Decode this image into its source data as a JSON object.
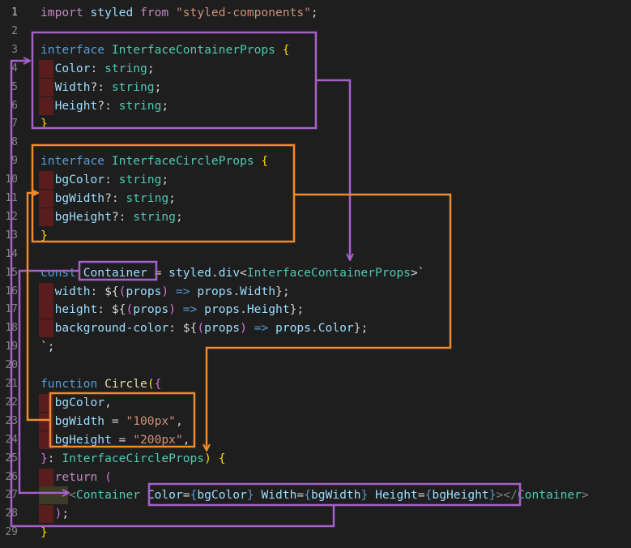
{
  "lines": [
    {
      "num": "1",
      "tokens": [
        {
          "c": "k",
          "t": "import"
        },
        {
          "c": "p",
          "t": " "
        },
        {
          "c": "v",
          "t": "styled"
        },
        {
          "c": "p",
          "t": " "
        },
        {
          "c": "k",
          "t": "from"
        },
        {
          "c": "p",
          "t": " "
        },
        {
          "c": "s",
          "t": "\"styled-components\""
        },
        {
          "c": "p",
          "t": ";"
        }
      ]
    },
    {
      "num": "2",
      "tokens": []
    },
    {
      "num": "3",
      "tokens": [
        {
          "c": "b",
          "t": "interface"
        },
        {
          "c": "p",
          "t": " "
        },
        {
          "c": "t",
          "t": "InterfaceContainerProps"
        },
        {
          "c": "p",
          "t": " "
        },
        {
          "c": "br1",
          "t": "{"
        }
      ]
    },
    {
      "num": "4",
      "tokens": [
        {
          "c": "p",
          "t": "  "
        },
        {
          "c": "v",
          "t": "Color"
        },
        {
          "c": "p",
          "t": ": "
        },
        {
          "c": "t",
          "t": "string"
        },
        {
          "c": "p",
          "t": ";"
        }
      ]
    },
    {
      "num": "5",
      "tokens": [
        {
          "c": "p",
          "t": "  "
        },
        {
          "c": "v",
          "t": "Width"
        },
        {
          "c": "p",
          "t": "?: "
        },
        {
          "c": "t",
          "t": "string"
        },
        {
          "c": "p",
          "t": ";"
        }
      ]
    },
    {
      "num": "6",
      "tokens": [
        {
          "c": "p",
          "t": "  "
        },
        {
          "c": "v",
          "t": "Height"
        },
        {
          "c": "p",
          "t": "?: "
        },
        {
          "c": "t",
          "t": "string"
        },
        {
          "c": "p",
          "t": ";"
        }
      ]
    },
    {
      "num": "7",
      "tokens": [
        {
          "c": "br1",
          "t": "}"
        }
      ]
    },
    {
      "num": "8",
      "tokens": []
    },
    {
      "num": "9",
      "tokens": [
        {
          "c": "b",
          "t": "interface"
        },
        {
          "c": "p",
          "t": " "
        },
        {
          "c": "t",
          "t": "InterfaceCircleProps"
        },
        {
          "c": "p",
          "t": " "
        },
        {
          "c": "br1",
          "t": "{"
        }
      ]
    },
    {
      "num": "10",
      "tokens": [
        {
          "c": "p",
          "t": "  "
        },
        {
          "c": "v",
          "t": "bgColor"
        },
        {
          "c": "p",
          "t": ": "
        },
        {
          "c": "t",
          "t": "string"
        },
        {
          "c": "p",
          "t": ";"
        }
      ]
    },
    {
      "num": "11",
      "tokens": [
        {
          "c": "p",
          "t": "  "
        },
        {
          "c": "v",
          "t": "bgWidth"
        },
        {
          "c": "p",
          "t": "?: "
        },
        {
          "c": "t",
          "t": "string"
        },
        {
          "c": "p",
          "t": ";"
        }
      ]
    },
    {
      "num": "12",
      "tokens": [
        {
          "c": "p",
          "t": "  "
        },
        {
          "c": "v",
          "t": "bgHeight"
        },
        {
          "c": "p",
          "t": "?: "
        },
        {
          "c": "t",
          "t": "string"
        },
        {
          "c": "p",
          "t": ";"
        }
      ]
    },
    {
      "num": "13",
      "tokens": [
        {
          "c": "br1",
          "t": "}"
        }
      ]
    },
    {
      "num": "14",
      "tokens": []
    },
    {
      "num": "15",
      "tokens": [
        {
          "c": "b",
          "t": "const"
        },
        {
          "c": "p",
          "t": " "
        },
        {
          "c": "v",
          "t": "Container"
        },
        {
          "c": "p",
          "t": " = "
        },
        {
          "c": "v",
          "t": "styled"
        },
        {
          "c": "p",
          "t": "."
        },
        {
          "c": "v",
          "t": "div"
        },
        {
          "c": "p",
          "t": "<"
        },
        {
          "c": "t",
          "t": "InterfaceContainerProps"
        },
        {
          "c": "p",
          "t": ">`"
        }
      ]
    },
    {
      "num": "16",
      "tokens": [
        {
          "c": "p",
          "t": "  "
        },
        {
          "c": "v",
          "t": "width"
        },
        {
          "c": "p",
          "t": ": "
        },
        {
          "c": "p",
          "t": "${"
        },
        {
          "c": "br2",
          "t": "("
        },
        {
          "c": "v",
          "t": "props"
        },
        {
          "c": "br2",
          "t": ")"
        },
        {
          "c": "p",
          "t": " "
        },
        {
          "c": "b",
          "t": "=>"
        },
        {
          "c": "p",
          "t": " "
        },
        {
          "c": "v",
          "t": "props"
        },
        {
          "c": "p",
          "t": "."
        },
        {
          "c": "v",
          "t": "Width"
        },
        {
          "c": "p",
          "t": "};"
        }
      ]
    },
    {
      "num": "17",
      "tokens": [
        {
          "c": "p",
          "t": "  "
        },
        {
          "c": "v",
          "t": "height"
        },
        {
          "c": "p",
          "t": ": "
        },
        {
          "c": "p",
          "t": "${"
        },
        {
          "c": "br2",
          "t": "("
        },
        {
          "c": "v",
          "t": "props"
        },
        {
          "c": "br2",
          "t": ")"
        },
        {
          "c": "p",
          "t": " "
        },
        {
          "c": "b",
          "t": "=>"
        },
        {
          "c": "p",
          "t": " "
        },
        {
          "c": "v",
          "t": "props"
        },
        {
          "c": "p",
          "t": "."
        },
        {
          "c": "v",
          "t": "Height"
        },
        {
          "c": "p",
          "t": "};"
        }
      ]
    },
    {
      "num": "18",
      "tokens": [
        {
          "c": "p",
          "t": "  "
        },
        {
          "c": "v",
          "t": "background-color"
        },
        {
          "c": "p",
          "t": ": "
        },
        {
          "c": "p",
          "t": "${"
        },
        {
          "c": "br2",
          "t": "("
        },
        {
          "c": "v",
          "t": "props"
        },
        {
          "c": "br2",
          "t": ")"
        },
        {
          "c": "p",
          "t": " "
        },
        {
          "c": "b",
          "t": "=>"
        },
        {
          "c": "p",
          "t": " "
        },
        {
          "c": "v",
          "t": "props"
        },
        {
          "c": "p",
          "t": "."
        },
        {
          "c": "v",
          "t": "Color"
        },
        {
          "c": "p",
          "t": "};"
        }
      ]
    },
    {
      "num": "19",
      "tokens": [
        {
          "c": "p",
          "t": "`;"
        }
      ]
    },
    {
      "num": "20",
      "tokens": []
    },
    {
      "num": "21",
      "tokens": [
        {
          "c": "b",
          "t": "function"
        },
        {
          "c": "p",
          "t": " "
        },
        {
          "c": "f",
          "t": "Circle"
        },
        {
          "c": "br1",
          "t": "("
        },
        {
          "c": "br2",
          "t": "{"
        }
      ]
    },
    {
      "num": "22",
      "tokens": [
        {
          "c": "p",
          "t": "  "
        },
        {
          "c": "v",
          "t": "bgColor"
        },
        {
          "c": "p",
          "t": ","
        }
      ]
    },
    {
      "num": "23",
      "tokens": [
        {
          "c": "p",
          "t": "  "
        },
        {
          "c": "v",
          "t": "bgWidth"
        },
        {
          "c": "p",
          "t": " = "
        },
        {
          "c": "s",
          "t": "\"100px\""
        },
        {
          "c": "p",
          "t": ","
        }
      ]
    },
    {
      "num": "24",
      "tokens": [
        {
          "c": "p",
          "t": "  "
        },
        {
          "c": "v",
          "t": "bgHeight"
        },
        {
          "c": "p",
          "t": " = "
        },
        {
          "c": "s",
          "t": "\"200px\""
        },
        {
          "c": "p",
          "t": ","
        }
      ]
    },
    {
      "num": "25",
      "tokens": [
        {
          "c": "br2",
          "t": "}"
        },
        {
          "c": "p",
          "t": ": "
        },
        {
          "c": "t",
          "t": "InterfaceCircleProps"
        },
        {
          "c": "br1",
          "t": ")"
        },
        {
          "c": "p",
          "t": " "
        },
        {
          "c": "br1",
          "t": "{"
        }
      ]
    },
    {
      "num": "26",
      "tokens": [
        {
          "c": "p",
          "t": "  "
        },
        {
          "c": "k",
          "t": "return"
        },
        {
          "c": "p",
          "t": " "
        },
        {
          "c": "br2",
          "t": "("
        }
      ]
    },
    {
      "num": "27",
      "tokens": [
        {
          "c": "p",
          "t": "    "
        },
        {
          "c": "tag",
          "t": "<"
        },
        {
          "c": "t",
          "t": "Container"
        },
        {
          "c": "p",
          "t": " "
        },
        {
          "c": "v",
          "t": "Color"
        },
        {
          "c": "p",
          "t": "="
        },
        {
          "c": "b",
          "t": "{"
        },
        {
          "c": "v",
          "t": "bgColor"
        },
        {
          "c": "b",
          "t": "}"
        },
        {
          "c": "p",
          "t": " "
        },
        {
          "c": "v",
          "t": "Width"
        },
        {
          "c": "p",
          "t": "="
        },
        {
          "c": "b",
          "t": "{"
        },
        {
          "c": "v",
          "t": "bgWidth"
        },
        {
          "c": "b",
          "t": "}"
        },
        {
          "c": "p",
          "t": " "
        },
        {
          "c": "v",
          "t": "Height"
        },
        {
          "c": "p",
          "t": "="
        },
        {
          "c": "b",
          "t": "{"
        },
        {
          "c": "v",
          "t": "bgHeight"
        },
        {
          "c": "b",
          "t": "}"
        },
        {
          "c": "tag",
          "t": "></"
        },
        {
          "c": "t",
          "t": "Container"
        },
        {
          "c": "tag",
          "t": ">"
        }
      ]
    },
    {
      "num": "28",
      "tokens": [
        {
          "c": "p",
          "t": "  "
        },
        {
          "c": "br2",
          "t": ")"
        },
        {
          "c": "p",
          "t": ";"
        }
      ]
    },
    {
      "num": "29",
      "tokens": [
        {
          "c": "br1",
          "t": "}"
        }
      ]
    }
  ],
  "colors": {
    "background": "#1e1e1e",
    "annotation_purple": "#a561c9",
    "annotation_orange": "#f08a2c",
    "indent_marker": "#5a1d1d"
  }
}
